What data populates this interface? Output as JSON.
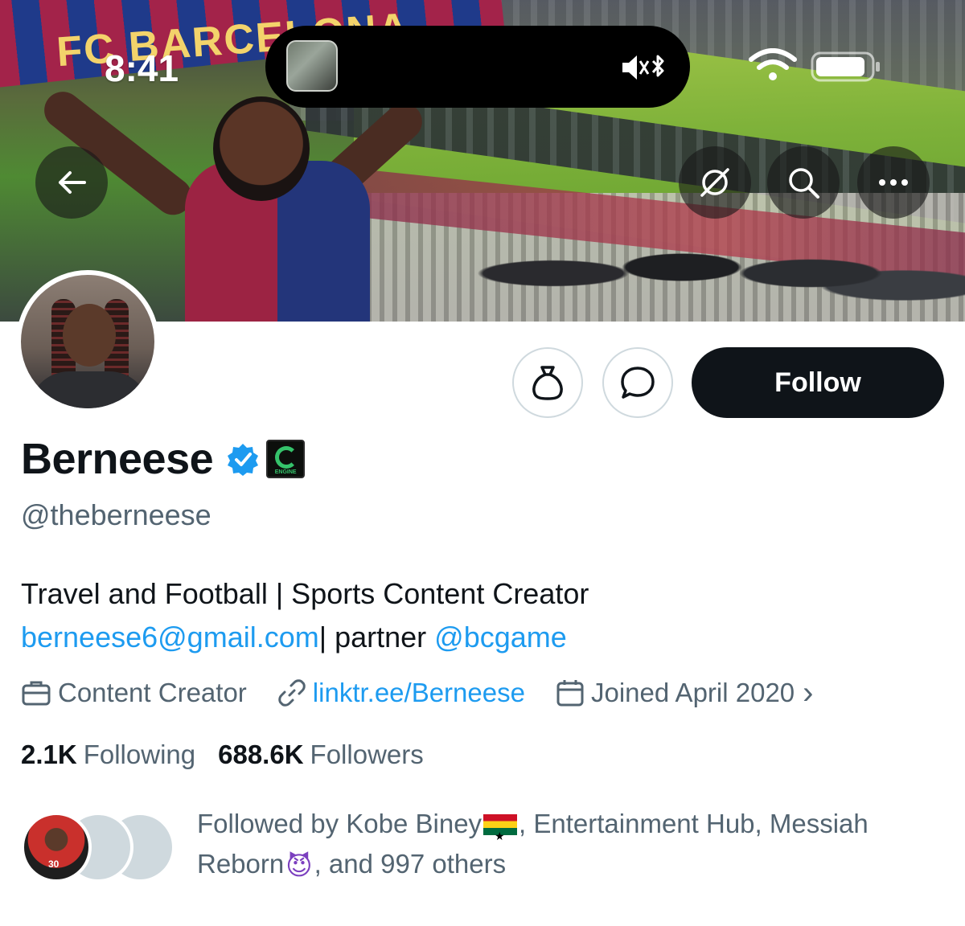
{
  "status_bar": {
    "time": "8:41"
  },
  "banner": {
    "scarf_text": "FC BARCELONA"
  },
  "nav": {
    "back_icon": "arrow-left-icon",
    "grok_icon": "grok-icon",
    "search_icon": "search-icon",
    "more_icon": "more-icon"
  },
  "actions": {
    "tip_icon": "money-bag-icon",
    "message_icon": "message-icon",
    "follow_label": "Follow"
  },
  "profile": {
    "name": "Berneese",
    "affiliate_badge_text": "ENGINE",
    "handle": "@theberneese",
    "bio_line1": "Travel and Football | Sports Content Creator",
    "bio_email": "berneese6@gmail.com",
    "bio_mid": "| partner ",
    "bio_mention": "@bcgame",
    "category": "Content Creator",
    "website": "linktr.ee/Berneese",
    "joined": "Joined April 2020 ",
    "joined_chevron": "›"
  },
  "stats": {
    "following_count": "2.1K",
    "following_label": "Following",
    "followers_count": "688.6K",
    "followers_label": "Followers"
  },
  "followed_by": {
    "prefix": "Followed by Kobe Biney",
    "middle": ", Entertainment Hub, Messiah Reborn",
    "suffix": ", and 997 others",
    "first_avatar_jersey": "30"
  },
  "colors": {
    "accent": "#1d9bf0",
    "text_primary": "#0f1419",
    "text_secondary": "#536471",
    "follow_bg": "#0f1419"
  }
}
